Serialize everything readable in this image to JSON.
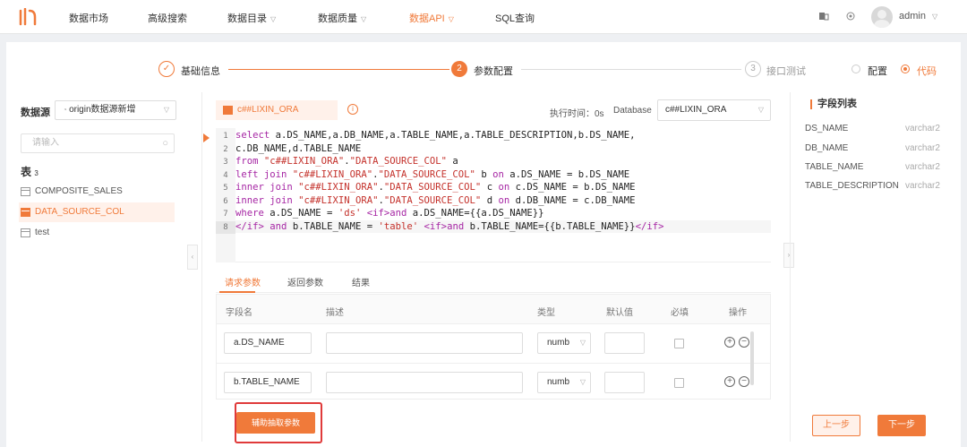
{
  "nav": {
    "items": [
      {
        "label": "数据市场",
        "has_caret": false,
        "active": false
      },
      {
        "label": "高级搜索",
        "has_caret": false,
        "active": false
      },
      {
        "label": "数据目录",
        "has_caret": true,
        "active": false
      },
      {
        "label": "数据质量",
        "has_caret": true,
        "active": false
      },
      {
        "label": "数据API",
        "has_caret": true,
        "active": true
      },
      {
        "label": "SQL查询",
        "has_caret": false,
        "active": false
      }
    ],
    "user": "admin",
    "icons": [
      "logo-icon",
      "screen-icon",
      "settings-icon",
      "avatar",
      "chevron-down-icon"
    ]
  },
  "steps": {
    "items": [
      {
        "num": "✓",
        "label": "基础信息",
        "state": "done"
      },
      {
        "num": "2",
        "label": "参数配置",
        "state": "current"
      },
      {
        "num": "3",
        "label": "接口测试",
        "state": "todo"
      }
    ],
    "modes": [
      {
        "label": "配置",
        "checked": false
      },
      {
        "label": "代码",
        "checked": true
      }
    ]
  },
  "left": {
    "datasource_label": "数据源",
    "datasource_value": "origin数据源新增",
    "search_placeholder": "请输入",
    "tables_label": "表",
    "tables_count": "3",
    "tables": [
      {
        "name": "COMPOSITE_SALES",
        "active": false
      },
      {
        "name": "DATA_SOURCE_COL",
        "active": true
      },
      {
        "name": "test",
        "active": false
      }
    ]
  },
  "center": {
    "datasource_tag": "c##LIXIN_ORA",
    "exec_time": "执行时间：0s",
    "database_label": "Database",
    "database_value": "c##LIXIN_ORA",
    "code_lines": [
      {
        "n": "1",
        "text": "select a.DS_NAME,a.DB_NAME,a.TABLE_NAME,a.TABLE_DESCRIPTION,b.DS_NAME,"
      },
      {
        "n": "2",
        "text": "c.DB_NAME,d.TABLE_NAME"
      },
      {
        "n": "3",
        "text": "from \"c##LIXIN_ORA\".\"DATA_SOURCE_COL\" a"
      },
      {
        "n": "4",
        "text": "left join \"c##LIXIN_ORA\".\"DATA_SOURCE_COL\" b on a.DS_NAME = b.DS_NAME"
      },
      {
        "n": "5",
        "text": "inner join \"c##LIXIN_ORA\".\"DATA_SOURCE_COL\" c on c.DS_NAME = b.DS_NAME"
      },
      {
        "n": "6",
        "text": "inner join \"c##LIXIN_ORA\".\"DATA_SOURCE_COL\" d on d.DB_NAME = c.DB_NAME"
      },
      {
        "n": "7",
        "text": "where a.DS_NAME = 'ds' <if>and a.DS_NAME={{a.DS_NAME}}"
      },
      {
        "n": "8",
        "text": "</if> and b.TABLE_NAME = 'table' <if>and b.TABLE_NAME={{b.TABLE_NAME}}</if>"
      }
    ],
    "tabs": [
      {
        "label": "请求参数",
        "active": true
      },
      {
        "label": "返回参数",
        "active": false
      },
      {
        "label": "结果",
        "active": false
      }
    ],
    "param_headers": [
      "字段名",
      "描述",
      "类型",
      "默认值",
      "必填",
      "操作"
    ],
    "params": [
      {
        "name": "a.DS_NAME",
        "desc": "",
        "type": "numb",
        "default": "",
        "required": false
      },
      {
        "name": "b.TABLE_NAME",
        "desc": "",
        "type": "numb",
        "default": "",
        "required": false
      }
    ]
  },
  "right": {
    "title": "字段列表",
    "fields": [
      {
        "name": "DS_NAME",
        "type": "varchar2"
      },
      {
        "name": "DB_NAME",
        "type": "varchar2"
      },
      {
        "name": "TABLE_NAME",
        "type": "varchar2"
      },
      {
        "name": "TABLE_DESCRIPTION",
        "type": "varchar2"
      }
    ]
  },
  "footer": {
    "assist_button": "辅助抽取参数",
    "prev_button": "上一步",
    "next_button": "下一步"
  },
  "colors": {
    "accent": "#f07a3a",
    "highlight": "#e03a3a"
  }
}
